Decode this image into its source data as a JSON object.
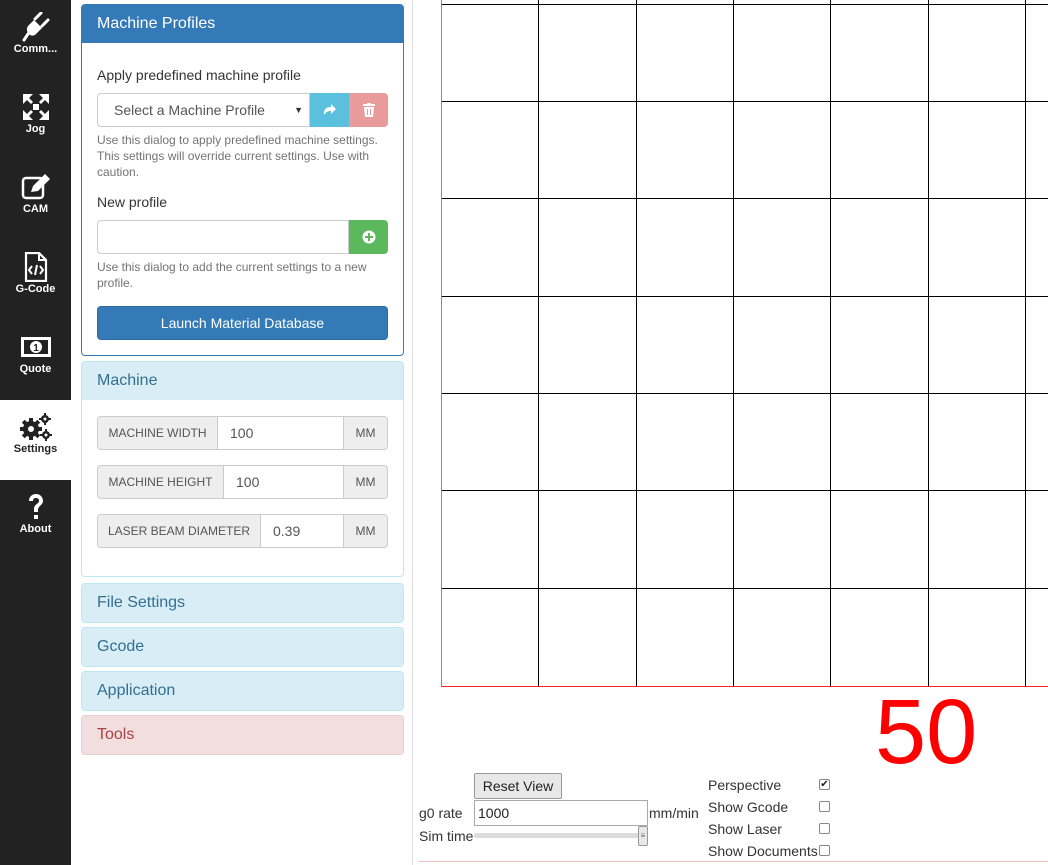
{
  "nav": {
    "items": [
      {
        "label": "Comm...",
        "icon": "plug-icon"
      },
      {
        "label": "Jog",
        "icon": "arrows-icon"
      },
      {
        "label": "CAM",
        "icon": "edit-icon"
      },
      {
        "label": "G-Code",
        "icon": "code-file-icon"
      },
      {
        "label": "Quote",
        "icon": "money-icon"
      },
      {
        "label": "Settings",
        "icon": "gears-icon"
      },
      {
        "label": "About",
        "icon": "question-icon"
      }
    ],
    "active_index": 5
  },
  "profiles": {
    "title": "Machine Profiles",
    "apply_label": "Apply predefined machine profile",
    "select_value": "Select a Machine Profile",
    "apply_help": "Use this dialog to apply predefined machine settings. This settings will override current settings. Use with caution.",
    "new_label": "New profile",
    "new_value": "",
    "new_help": "Use this dialog to add the current settings to a new profile.",
    "launch_label": "Launch Material Database"
  },
  "machine": {
    "title": "Machine",
    "fields": [
      {
        "label": "MACHINE WIDTH",
        "value": "100",
        "unit": "MM"
      },
      {
        "label": "MACHINE HEIGHT",
        "value": "100",
        "unit": "MM"
      },
      {
        "label": "LASER BEAM DIAMETER",
        "value": "0.39",
        "unit": "MM"
      }
    ]
  },
  "sections": {
    "file_settings": "File Settings",
    "gcode": "Gcode",
    "application": "Application",
    "tools": "Tools"
  },
  "viewer": {
    "big_number": "50",
    "reset_label": "Reset View",
    "g0_label": "g0 rate",
    "g0_value": "1000",
    "g0_unit": "mm/min",
    "sim_label": "Sim time",
    "options": [
      {
        "label": "Perspective",
        "checked": true
      },
      {
        "label": "Show Gcode",
        "checked": false
      },
      {
        "label": "Show Laser",
        "checked": false
      },
      {
        "label": "Show Documents",
        "checked": false
      }
    ]
  },
  "colors": {
    "primary": "#337ab7",
    "info_bg": "#d9edf7",
    "success": "#5cb85c",
    "info_btn": "#5bc0de",
    "danger_btn": "#e89b9a",
    "big_number": "#ff0000"
  }
}
